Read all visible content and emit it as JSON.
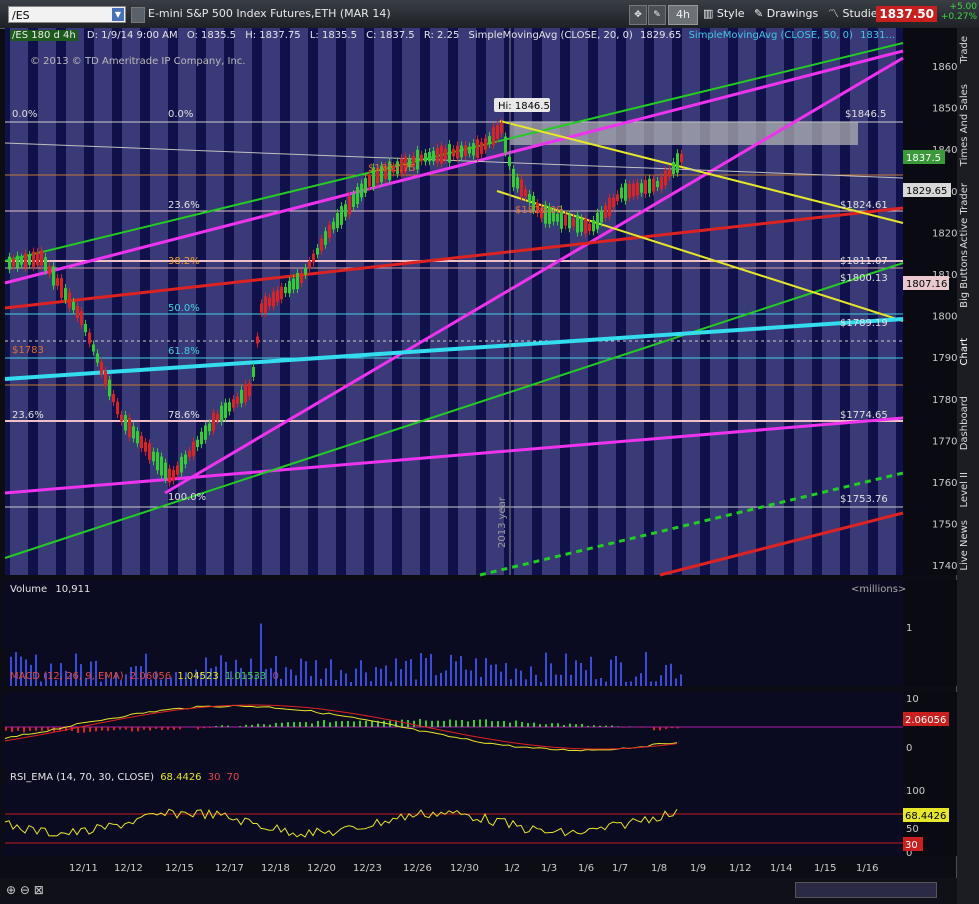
{
  "toolbar": {
    "symbol": "/ES",
    "title": "E-mini S&P 500 Index Futures,ETH (MAR 14)",
    "timeframe": "4h",
    "style_label": "Style",
    "drawings_label": "Drawings",
    "studies_label": "Studies",
    "last_price": "1837.50",
    "change_pts": "+5.00",
    "change_pct": "+0.27%"
  },
  "sidebar": {
    "tabs": [
      "Trade",
      "Times And Sales",
      "Active Trader",
      "Big Buttons",
      "Chart",
      "Dashboard",
      "Level II",
      "Live News"
    ]
  },
  "price_panel": {
    "header": {
      "sym": "/ES 180 d 4h",
      "date": "D: 1/9/14 9:00 AM",
      "open": "O: 1835.5",
      "high": "H: 1837.75",
      "low": "L: 1835.5",
      "close": "C: 1837.5",
      "range": "R: 2.25",
      "sma20": "SimpleMovingAvg (CLOSE, 20, 0)",
      "sma20_val": "1829.65",
      "sma50": "SimpleMovingAvg (CLOSE, 50, 0)",
      "sma50_val": "1831..."
    },
    "copyright": "© 2013 © TD Ameritrade IP Company, Inc.",
    "y_axis_labels": [
      "1860",
      "1850",
      "1840",
      "1830",
      "1820",
      "1810",
      "1800",
      "1790",
      "1780",
      "1770",
      "1760",
      "1750",
      "1740"
    ],
    "high_label": "Hi: 1846.5",
    "year_label": "2013 year",
    "fib_pct": [
      "0.0%",
      "0.0%",
      "23.6%",
      "38.2%",
      "50.0%",
      "61.8%",
      "78.6%",
      "100.0%",
      "23.6%"
    ],
    "price_tags": [
      "$1846.5",
      "$1824.61",
      "$1811.07",
      "$1800.13",
      "$1789.19",
      "$1774.65",
      "$1753.76",
      "$1783",
      "$1833.75",
      "$1826.09"
    ],
    "axis_markers": [
      {
        "text": "1837.5",
        "color": "#3a9a3a"
      },
      {
        "text": "1829.65",
        "color": "#d8d8d8"
      },
      {
        "text": "1807.16",
        "color": "#e9c9cf"
      }
    ]
  },
  "volume_panel": {
    "label": "Volume",
    "value": "10,911",
    "units": "<millions>",
    "axis": "1"
  },
  "macd_panel": {
    "label": "MACD (12, 26, 9, EMA)",
    "v1": "2.06056",
    "v2": "1.04523",
    "v3": "1.01533",
    "v4": "0",
    "axis": [
      "10",
      "0"
    ],
    "marker": "2.06056"
  },
  "rsi_panel": {
    "label": "RSI_EMA (14, 70, 30, CLOSE)",
    "v1": "68.4426",
    "v2": "30",
    "v3": "70",
    "axis": [
      "100",
      "50",
      "0"
    ],
    "markers": [
      "68.4426",
      "30"
    ]
  },
  "x_axis": [
    "12/11",
    "12/12",
    "12/15",
    "12/17",
    "12/18",
    "12/20",
    "12/23",
    "12/26",
    "12/30",
    "1/2",
    "1/3",
    "1/6",
    "1/7",
    "1/8",
    "1/9",
    "1/12",
    "1/14",
    "1/15",
    "1/16"
  ]
}
